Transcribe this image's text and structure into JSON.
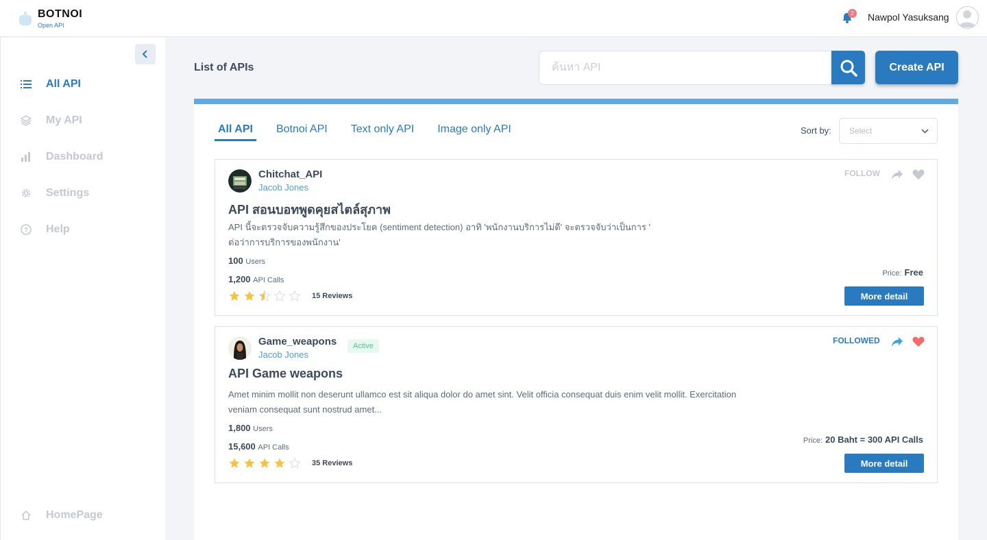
{
  "app": {
    "title": "BOTNOI",
    "subtitle": "Open API"
  },
  "header": {
    "notification_count": "2",
    "user_name": "Nawpol Yasuksang"
  },
  "sidebar": {
    "items": [
      {
        "label": "All API",
        "icon": "list-icon",
        "active": true
      },
      {
        "label": "My API",
        "icon": "layers-icon",
        "active": false
      },
      {
        "label": "Dashboard",
        "icon": "bar-chart-icon",
        "active": false
      },
      {
        "label": "Settings",
        "icon": "gear-icon",
        "active": false
      },
      {
        "label": "Help",
        "icon": "help-circle-icon",
        "active": false
      }
    ],
    "footer_item": {
      "label": "HomePage",
      "icon": "home-icon"
    }
  },
  "main": {
    "page_title": "List of APIs",
    "search": {
      "placeholder": "ค้นหา API",
      "value": ""
    },
    "create_button": "Create API",
    "tabs": [
      "All API",
      "Botnoi API",
      "Text only API",
      "Image only API"
    ],
    "active_tab": "All API",
    "sort": {
      "label": "Sort by:",
      "value": "Select"
    }
  },
  "cards": [
    {
      "name": "Chitchat_API",
      "author": "Jacob Jones",
      "badge": "",
      "title": "API สอนบอทพูดคุยสไตล์สุภาพ",
      "description_line1": "API นี้จะตรวจจับความรู้สึกของประโยค (sentiment detection) อาทิ 'พนักงานบริการไม่ดี' จะตรวจจับว่าเป็นการ '",
      "description_line2": "ต่อว่าการบริการของพนักงาน'",
      "users": "100",
      "users_label": "Users",
      "calls": "1,200",
      "calls_label": "API Calls",
      "rating": 2.5,
      "reviews": "15 Reviews",
      "follow_label": "FOLLOW",
      "followed": false,
      "price_label": "Price:",
      "price": "Free",
      "detail_button": "More detail"
    },
    {
      "name": "Game_weapons",
      "author": "Jacob Jones",
      "badge": "Active",
      "title": "API Game weapons",
      "description_line1": "Amet minim mollit non deserunt ullamco est sit aliqua dolor do amet sint. Velit officia consequat duis enim velit mollit. Exercitation",
      "description_line2": "veniam consequat sunt nostrud amet...",
      "users": "1,800",
      "users_label": "Users",
      "calls": "15,600",
      "calls_label": "API Calls",
      "rating": 4,
      "reviews": "35 Reviews",
      "follow_label": "FOLLOWED",
      "followed": true,
      "price_label": "Price:",
      "price": "20 Baht = 300 API Calls",
      "detail_button": "More detail"
    }
  ],
  "colors": {
    "accent": "#2a7ac0",
    "star": "#f5c341",
    "heart_active": "#f26c6c",
    "badge": "#52c49a"
  }
}
